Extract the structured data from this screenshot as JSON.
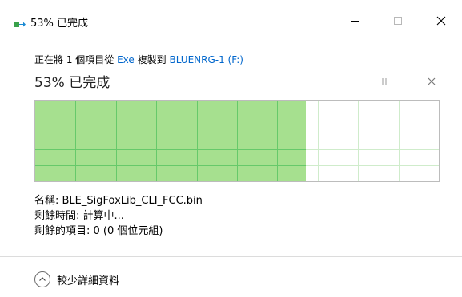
{
  "window": {
    "title": "53% 已完成",
    "minimize_icon": "minimize-icon",
    "maximize_icon": "maximize-icon",
    "close_icon": "close-icon"
  },
  "copy": {
    "prefix": "正在將 1 個項目從",
    "source": "Exe",
    "middle": "複製到",
    "destination": "BLUENRG-1 (F:)",
    "link_color": "#0066cc"
  },
  "progress": {
    "title": "53% 已完成",
    "percent": 53,
    "fill_color": "#a6e08f",
    "grid_color": "#66c96a",
    "pause_icon": "pause-icon",
    "cancel_icon": "cancel-icon"
  },
  "details": {
    "name": "名稱: BLE_SigFoxLib_CLI_FCC.bin",
    "time_remaining": "剩餘時間: 計算中...",
    "items_remaining": "剩餘的項目: 0 (0 個位元組)"
  },
  "footer": {
    "label": "較少詳細資料",
    "icon": "chevron-up-icon"
  }
}
